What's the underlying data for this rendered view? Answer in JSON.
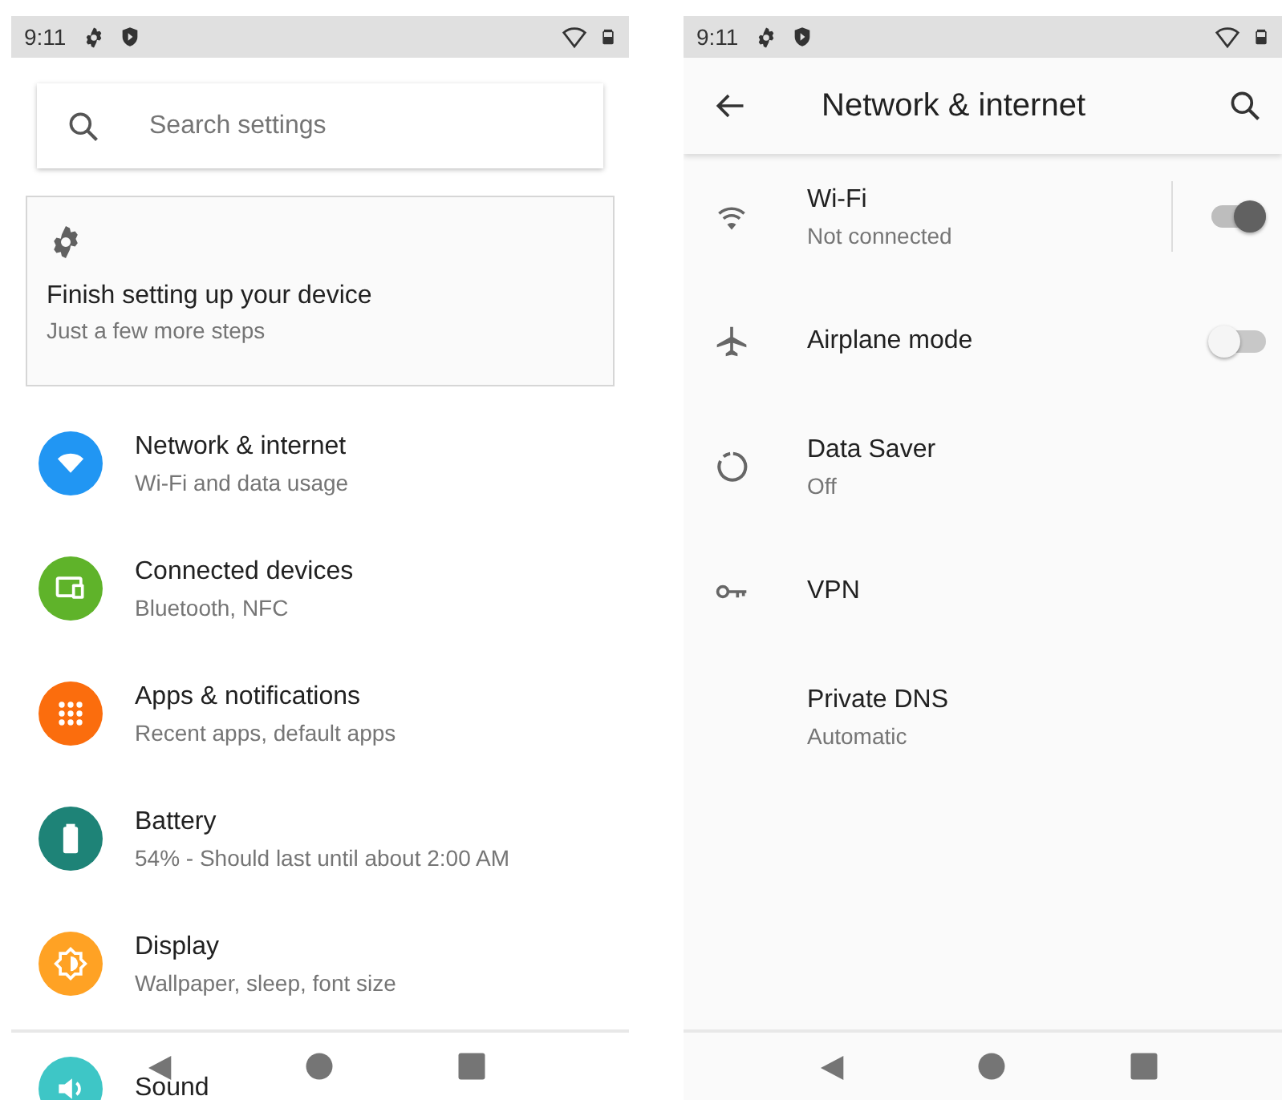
{
  "left": {
    "status_bar": {
      "time": "9:11"
    },
    "search": {
      "placeholder": "Search settings"
    },
    "suggestion": {
      "title": "Finish setting up your device",
      "summary": "Just a few more steps"
    },
    "categories": [
      {
        "title": "Network & internet",
        "summary": "Wi-Fi and data usage",
        "color": "#2196f3"
      },
      {
        "title": "Connected devices",
        "summary": "Bluetooth, NFC",
        "color": "#5fb32a"
      },
      {
        "title": "Apps & notifications",
        "summary": "Recent apps, default apps",
        "color": "#fb6d0d"
      },
      {
        "title": "Battery",
        "summary": "54% - Should last until about 2:00 AM",
        "color": "#1e8377"
      },
      {
        "title": "Display",
        "summary": "Wallpaper, sleep, font size",
        "color": "#ffa224"
      },
      {
        "title": "Sound",
        "color": "#3ec6c6"
      }
    ]
  },
  "right": {
    "status_bar": {
      "time": "9:11"
    },
    "toolbar": {
      "title": "Network & internet"
    },
    "items": [
      {
        "kind": "split-toggle",
        "title": "Wi-Fi",
        "summary": "Not connected",
        "on": true
      },
      {
        "kind": "toggle",
        "title": "Airplane mode",
        "on": false
      },
      {
        "kind": "plain",
        "title": "Data Saver",
        "summary": "Off"
      },
      {
        "kind": "plain",
        "title": "VPN"
      },
      {
        "kind": "plain",
        "title": "Private DNS",
        "summary": "Automatic"
      }
    ]
  }
}
